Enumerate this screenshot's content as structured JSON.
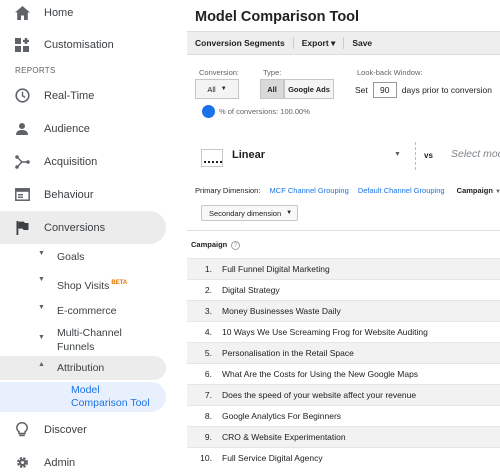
{
  "sidebar": {
    "home": "Home",
    "customisation": "Customisation",
    "reports_label": "REPORTS",
    "realtime": "Real-Time",
    "audience": "Audience",
    "acquisition": "Acquisition",
    "behaviour": "Behaviour",
    "conversions": "Conversions",
    "goals": "Goals",
    "shop_visits": "Shop Visits",
    "beta": "BETA",
    "ecommerce": "E-commerce",
    "multichannel_1": "Multi-Channel",
    "multichannel_2": "Funnels",
    "attribution": "Attribution",
    "model_comparison_1": "Model",
    "model_comparison_2": "Comparison Tool",
    "discover": "Discover",
    "admin": "Admin"
  },
  "main": {
    "title": "Model Comparison Tool",
    "toolbar": {
      "segments": "Conversion Segments",
      "export": "Export ▾",
      "save": "Save"
    },
    "conversion_label": "Conversion:",
    "conversion_value": "All",
    "type_label": "Type:",
    "type_all": "All",
    "type_google_ads": "Google Ads",
    "lookback_label": "Look-back Window:",
    "set_label": "Set",
    "days_value": "90",
    "days_suffix": "days prior to conversion",
    "pct_text": "% of conversions: 100.00%",
    "model_name": "Linear",
    "vs": "vs",
    "select_model": "Select mod",
    "primary_dimension_label": "Primary Dimension:",
    "dim_mcf": "MCF Channel Grouping",
    "dim_default": "Default Channel Grouping",
    "dim_campaign": "Campaign",
    "secondary_dimension": "Secondary dimension",
    "column_campaign": "Campaign",
    "help_glyph": "?",
    "accent_color": "#1a73e8"
  },
  "table": {
    "rows": [
      {
        "num": "1.",
        "name": "Full Funnel Digital Marketing"
      },
      {
        "num": "2.",
        "name": "Digital Strategy"
      },
      {
        "num": "3.",
        "name": "Money Businesses Waste Daily"
      },
      {
        "num": "4.",
        "name": "10 Ways We Use Screaming Frog for Website Auditing"
      },
      {
        "num": "5.",
        "name": "Personalisation in the Retail Space"
      },
      {
        "num": "6.",
        "name": "What Are the Costs for Using the New Google Maps"
      },
      {
        "num": "7.",
        "name": "Does the speed of your website affect your revenue"
      },
      {
        "num": "8.",
        "name": "Google Analytics For Beginners"
      },
      {
        "num": "9.",
        "name": "CRO & Website Experimentation"
      },
      {
        "num": "10.",
        "name": "Full Service Digital Agency"
      }
    ]
  }
}
